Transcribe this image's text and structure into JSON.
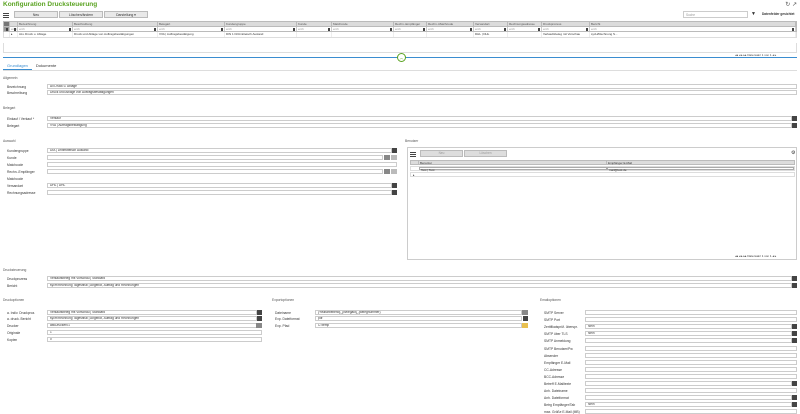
{
  "app": {
    "title": "Konfiguration Drucksteuerung",
    "search_placeholder": "Suche",
    "dsg_label": "Datenfelder gesichtet"
  },
  "toolbar": {
    "neu": "Neu",
    "loeschen": "Löschen/ändern",
    "darstellung": "Darstellung ▾"
  },
  "grid": {
    "columns": [
      "Bezeichnung",
      "Beschreibung",
      "Belegart",
      "Kundengruppe",
      "Kunde",
      "Matchcode",
      "Rechn.-Empfänger",
      "Rechn.-Matchcode",
      "Versandart",
      "Rechnungsadresse",
      "Druckprozess",
      "Bericht"
    ],
    "filter": "enth",
    "row": [
      "ALL Druck u. Ablage",
      "Druck und Ablage von Auftragsbestätigungen",
      "VVA | Auftragsbestätigung",
      "DIN 1 Drittmitteisch Ausland",
      "",
      "",
      "",
      "",
      "DHL | DHL",
      "",
      "Verkaufsbeleg mit Vorschau",
      "sycH/Rechnung S..."
    ],
    "pager": "Datensatz 1 von 1"
  },
  "tabs": {
    "grundlagen": "Grundlagen",
    "dokumente": "Dokumente"
  },
  "allgemein": {
    "title": "Allgemein",
    "bez_label": "Bezeichnung",
    "bez_value": "All Druck u. Ablage",
    "besch_label": "Beschreibung",
    "besch_value": "Druck und Ablage von Auftragsbestätigungen"
  },
  "belegart": {
    "title": "Belegart",
    "vk_label": "Einkauf / Verkauf *",
    "vk_value": "Verkauf",
    "ba_label": "Belegart",
    "ba_value": "VVA | Auftragsbestätigung"
  },
  "auswahl": {
    "title": "Auswahl",
    "kg_label": "Kundengruppe",
    "kg_value": "DIA | Drittmitteisch Ausland",
    "kunde_label": "Kunde",
    "mc_label": "Matchcode",
    "re_label": "Rechn.-Empfänger",
    "remc_label": "Matchcode",
    "va_label": "Versandart",
    "va_value": "DHL | DHL",
    "ra_label": "Rechnungsadresse"
  },
  "benutzer": {
    "title": "Benutzer",
    "neu": "Neu",
    "loeschen": "Löschen",
    "col1": "Benutzer",
    "col2": "Empfänger E-Mail",
    "row_user": "Test | Test",
    "row_mail": "mail@test.de",
    "pager": "Datensatz 1 von 1"
  },
  "drucksteuerung": {
    "title": "Drucksteuerung",
    "dp_label": "Druckprozess",
    "dp_value": "Verkaufsbeleg mit Vorschau | Standard",
    "ber_label": "Bericht",
    "ber_value": "sycH/Rechnung Tagesfinal | Angebot, Auftrag und Rechnungen"
  },
  "druckoptionen": {
    "title": "Druckoptionen",
    "ad_label": "a. Indiv. Druckproz.",
    "ad_value": "Verkaufsbeleg mit Vorschau | Standard",
    "ab_label": "a. druck. Bericht",
    "ab_value": "sycH/Rechnung Tagesfinal | Angebot, Auftrag und Rechnungen",
    "dr_label": "Drucker",
    "dr_value": "abcDrucker01",
    "or_label": "Originale",
    "or_value": "1",
    "ko_label": "Kopien",
    "ko_value": "0"
  },
  "export": {
    "title": "Exportoptionen",
    "dn_label": "Dateiname",
    "dn_value": "{%Mitarbeiterld}_{Belegakt}_{Belegnummer}",
    "ef_label": "Exp. Dateiformat",
    "ef_value": "pdf",
    "ep_label": "Exp. Pfad",
    "ep_value": "C:\\temp"
  },
  "email": {
    "title": "Emailoptionen",
    "fields": [
      "SMTP Server",
      "SMTP Port",
      "Zertifikatsprüf. überspr.",
      "SMTP über TLS",
      "SMTP Anmeldung",
      "SMTP Benutzer/Pw",
      "Absender",
      "Empfänger E-Mail",
      "CC-Adresse",
      "BCC-Adresse",
      "Betreff E-Mailtexte",
      "Anh. Dateiname",
      "Anh. Dateiformat",
      "Betrg Empfänger/Tab",
      "max. Größe E-Mail (MB)"
    ],
    "values": [
      "",
      "",
      "Nein",
      "Nein",
      "",
      "",
      "",
      "",
      "",
      "",
      "",
      "",
      "",
      "Nein",
      ""
    ]
  }
}
